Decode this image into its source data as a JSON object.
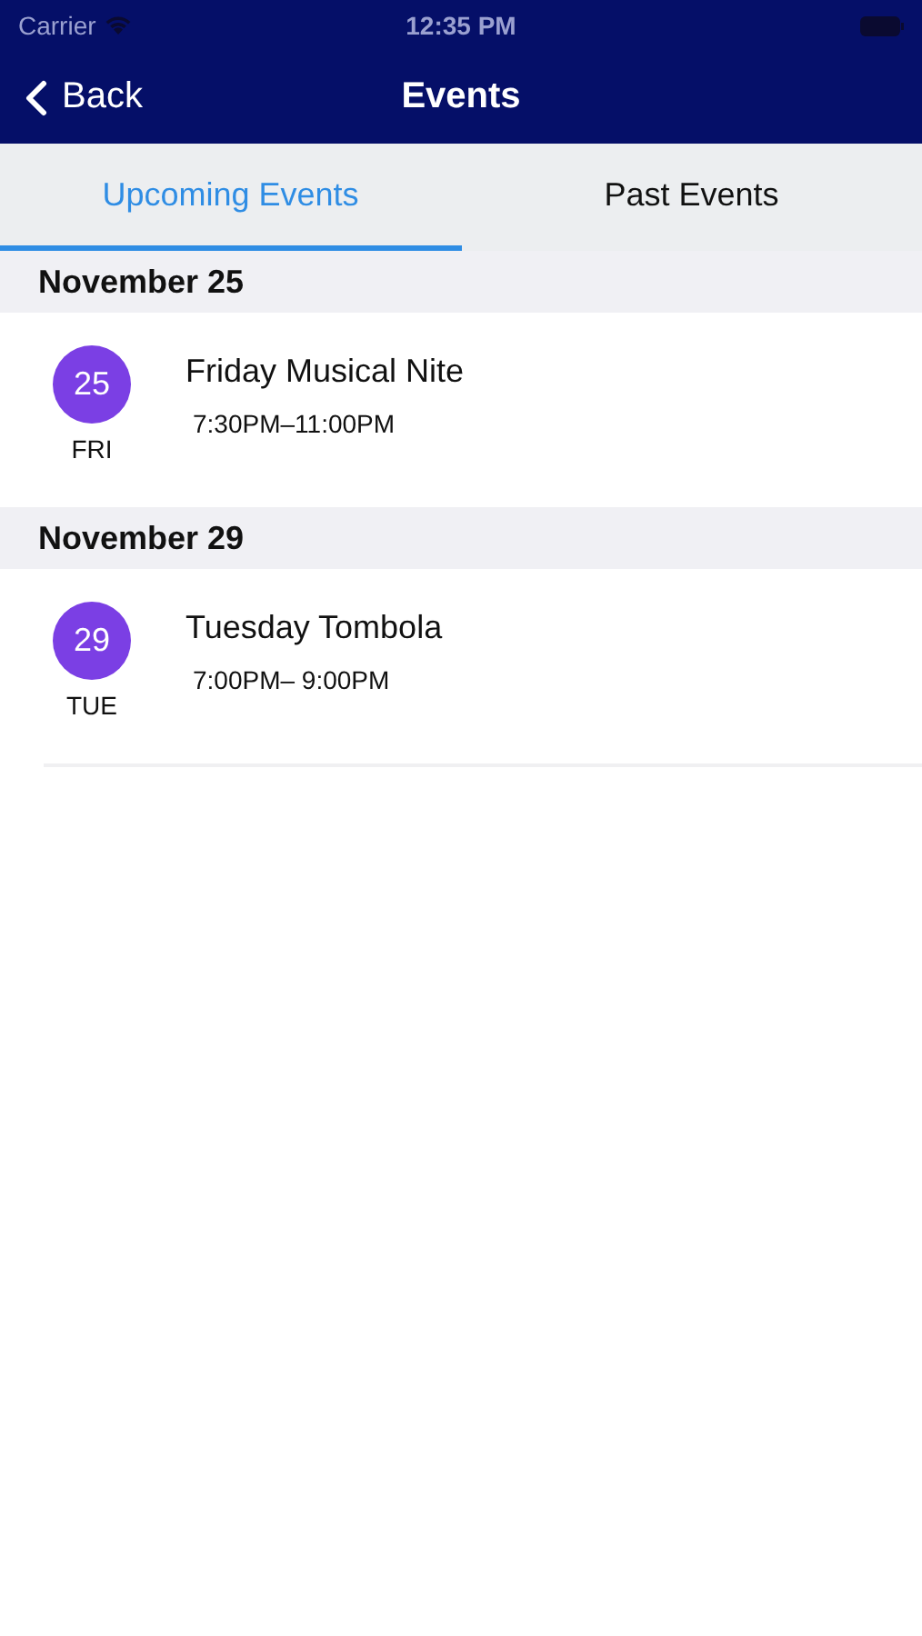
{
  "status_bar": {
    "carrier": "Carrier",
    "time": "12:35 PM"
  },
  "nav_bar": {
    "back": "Back",
    "title": "Events"
  },
  "tabs": [
    {
      "label": "Upcoming Events",
      "selected": true
    },
    {
      "label": "Past Events",
      "selected": false
    }
  ],
  "sections": [
    {
      "header": "November 25",
      "events": [
        {
          "day": "25",
          "weekday": "FRI",
          "title": "Friday Musical Nite",
          "time": "7:30PM–11:00PM",
          "color": "#7b3fe4"
        }
      ]
    },
    {
      "header": "November 29",
      "events": [
        {
          "day": "29",
          "weekday": "TUE",
          "title": "Tuesday Tombola",
          "time": "7:00PM– 9:00PM",
          "color": "#7b3fe4"
        }
      ]
    }
  ]
}
